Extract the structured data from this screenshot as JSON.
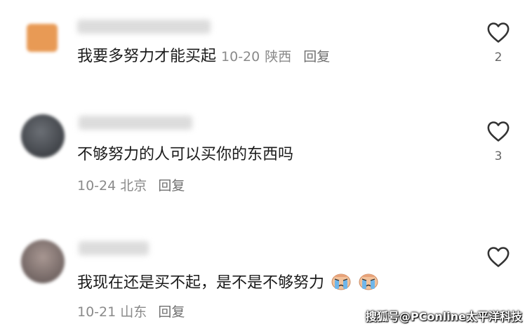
{
  "comments": [
    {
      "text": "我要多努力才能买起",
      "date": "10-20",
      "location": "陕西",
      "reply_label": "回复",
      "likes": "2",
      "avatar_color": "#e89a55"
    },
    {
      "text": "不够努力的人可以买你的东西吗",
      "date": "10-24",
      "location": "北京",
      "reply_label": "回复",
      "likes": "3",
      "avatar_color": "#4a4e55"
    },
    {
      "text": "我现在还是买不起，是不是不够努力",
      "date": "10-21",
      "location": "山东",
      "reply_label": "回复",
      "likes": "",
      "avatar_color": "#8a7a76"
    }
  ],
  "icons": {
    "like": "heart-outline-icon",
    "emoji": "crying-face-emoji"
  },
  "watermark": "搜狐号@PConline太平洋科技"
}
